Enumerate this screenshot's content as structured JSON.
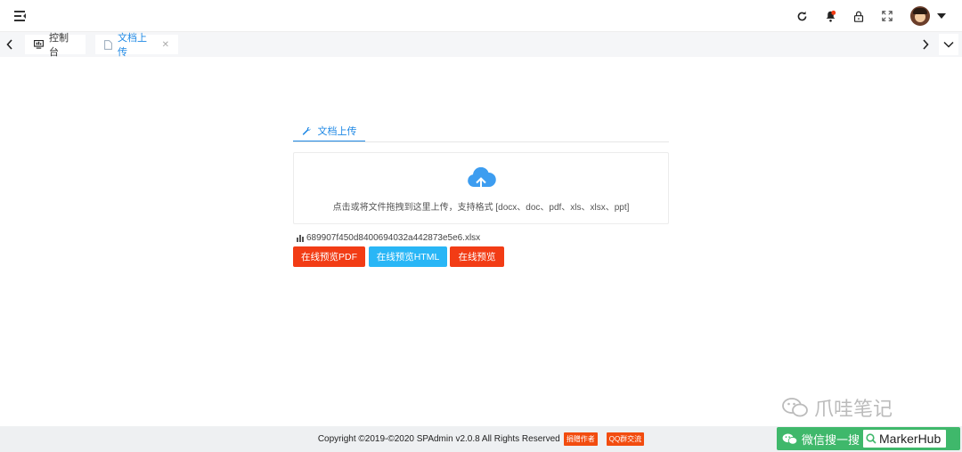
{
  "header": {
    "icons": [
      "menu-toggle-icon",
      "refresh-icon",
      "notification-bell-icon",
      "lock-icon",
      "fullscreen-icon",
      "avatar",
      "caret-down-icon"
    ]
  },
  "tabs": [
    {
      "label": "控制台",
      "icon": "monitor-icon",
      "active": false
    },
    {
      "label": "文档上传",
      "icon": "document-icon",
      "active": true
    }
  ],
  "upload": {
    "panel_tab": "文档上传",
    "hint": "点击或将文件拖拽到这里上传，支持格式 [docx、doc、pdf、xls、xlsx、ppt]",
    "file_name": "689907f450d8400694032a442873e5e6.xlsx"
  },
  "buttons": [
    {
      "label": "在线预览PDF",
      "color": "#f23c15"
    },
    {
      "label": "在线预览HTML",
      "color": "#29b6f6"
    },
    {
      "label": "在线预览",
      "color": "#f23c15"
    }
  ],
  "footer": {
    "copyright": "Copyright ©2019-©2020 SPAdmin v2.0.8 All Rights Reserved",
    "donate": "捐赠作者",
    "qq": "QQ群交流"
  },
  "watermark": {
    "title": "爪哇笔记",
    "wechat_label": "微信搜一搜",
    "search_text": "MarkerHub"
  },
  "colors": {
    "accent": "#1e88e5",
    "danger": "#f23c15",
    "info": "#29b6f6",
    "wechat": "#3fb86b"
  }
}
